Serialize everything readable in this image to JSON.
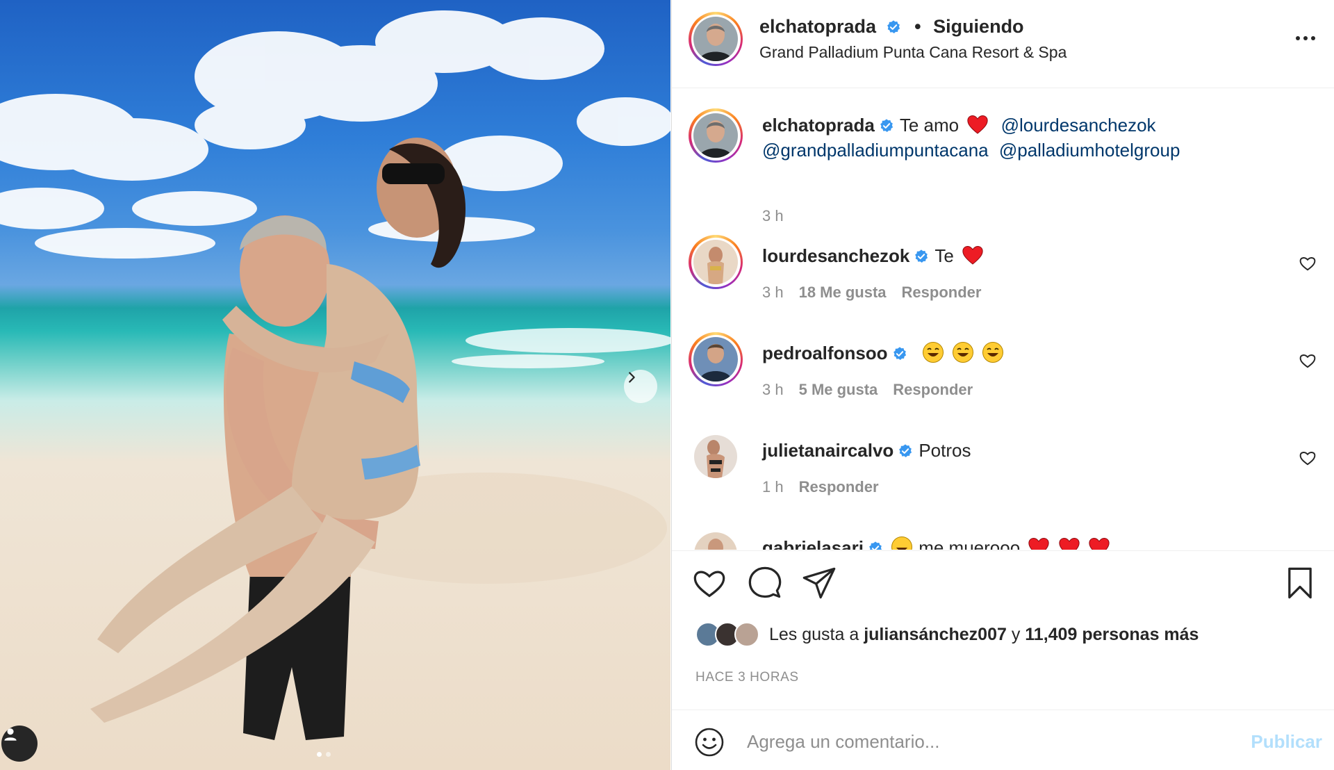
{
  "post": {
    "author": "elchatoprada",
    "follow_status": "Siguiendo",
    "separator": "•",
    "location": "Grand Palladium Punta Cana Resort & Spa",
    "more_icon": "more-horizontal-icon"
  },
  "caption": {
    "user": "elchatoprada",
    "text": "Te amo",
    "mentions": [
      "@lourdesanchezok",
      "@grandpalladiumpuntacana",
      "@palladiumhotelgroup"
    ],
    "time": "3 h"
  },
  "comments": [
    {
      "user": "lourdesanchezok",
      "text": "Te",
      "time": "3 h",
      "likes": "18 Me gusta",
      "reply": "Responder",
      "emoji": "heart"
    },
    {
      "user": "pedroalfonsoo",
      "text": "",
      "time": "3 h",
      "likes": "5 Me gusta",
      "reply": "Responder",
      "emoji": "laugh"
    },
    {
      "user": "julietanaircalvo",
      "text": "Potros",
      "time": "1 h",
      "likes": "",
      "reply": "Responder",
      "emoji": ""
    },
    {
      "user": "gabrielasari",
      "text": "me muerooo",
      "time": "",
      "likes": "",
      "reply": "",
      "emoji": "heart"
    }
  ],
  "actions": {
    "like_icon": "heart-icon",
    "comment_icon": "comment-icon",
    "share_icon": "send-icon",
    "save_icon": "bookmark-icon"
  },
  "likes": {
    "prefix": "Les gusta a",
    "user": "juliansánchez007",
    "joiner": "y",
    "others": "11,409 personas más"
  },
  "timestamp": "HACE 3 HORAS",
  "composer": {
    "placeholder": "Agrega un comentario...",
    "publish_label": "Publicar"
  },
  "colors": {
    "verified": "#3897f0",
    "mention": "#00376b",
    "muted": "#8e8e8e",
    "publish_disabled": "#b2dffc",
    "heart_red": "#ed1c24"
  }
}
